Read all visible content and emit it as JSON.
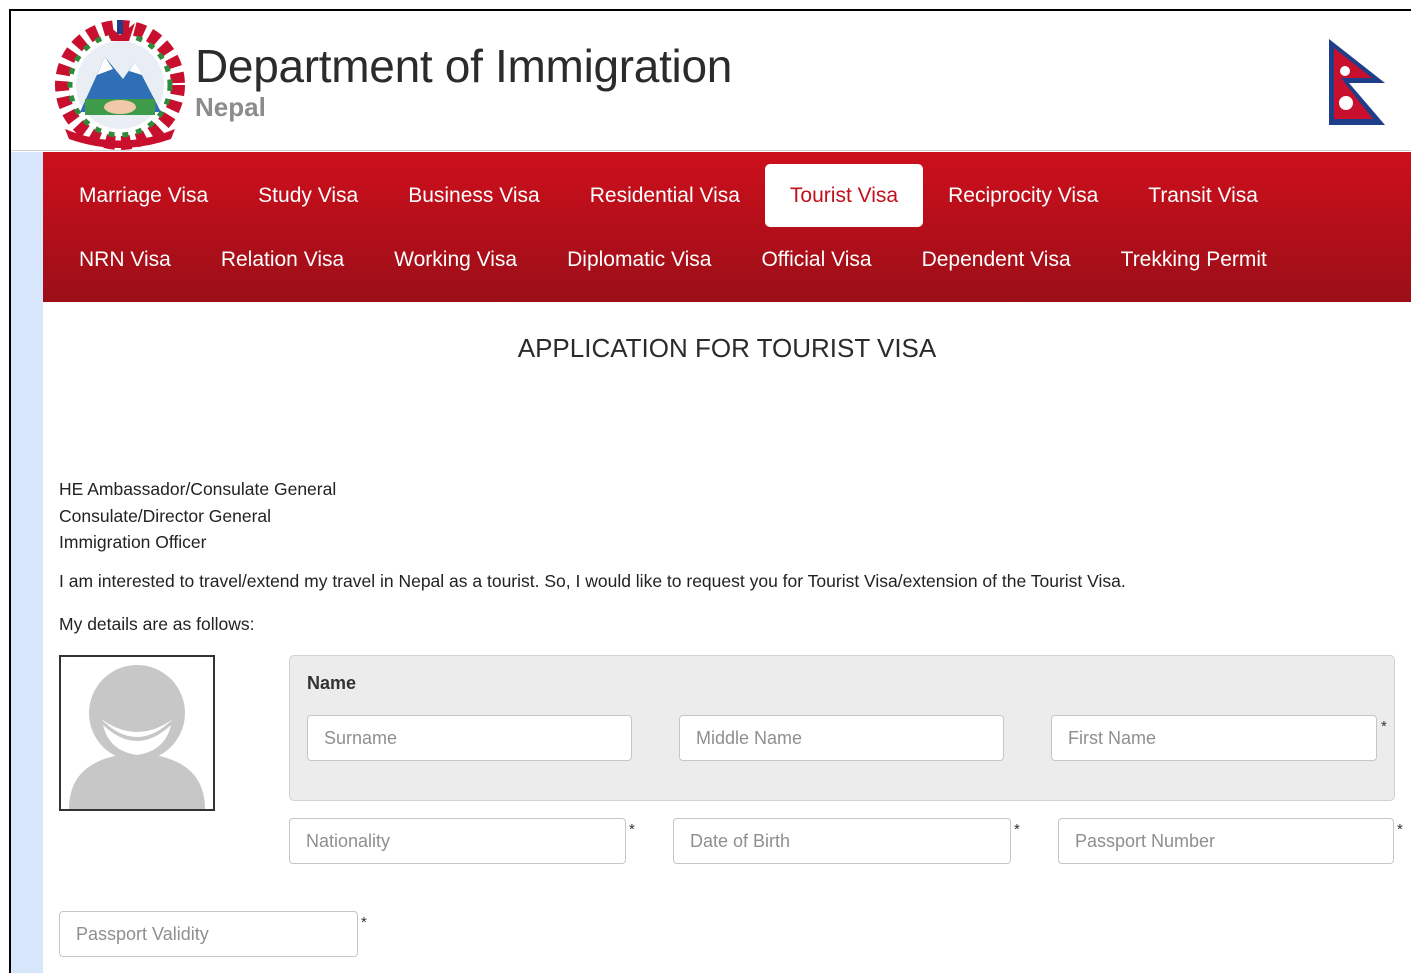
{
  "header": {
    "title": "Department of Immigration",
    "subtitle": "Nepal"
  },
  "nav": {
    "row1": [
      {
        "label": "Marriage Visa",
        "active": false
      },
      {
        "label": "Study Visa",
        "active": false
      },
      {
        "label": "Business Visa",
        "active": false
      },
      {
        "label": "Residential Visa",
        "active": false
      },
      {
        "label": "Tourist Visa",
        "active": true
      },
      {
        "label": "Reciprocity Visa",
        "active": false
      },
      {
        "label": "Transit Visa",
        "active": false
      }
    ],
    "row2": [
      {
        "label": "NRN Visa",
        "active": false
      },
      {
        "label": "Relation Visa",
        "active": false
      },
      {
        "label": "Working Visa",
        "active": false
      },
      {
        "label": "Diplomatic Visa",
        "active": false
      },
      {
        "label": "Official Visa",
        "active": false
      },
      {
        "label": "Dependent Visa",
        "active": false
      },
      {
        "label": "Trekking Permit",
        "active": false
      }
    ]
  },
  "page": {
    "heading": "APPLICATION FOR TOURIST VISA",
    "address_lines": [
      "HE Ambassador/Consulate General",
      "Consulate/Director General",
      "Immigration Officer"
    ],
    "request_text": "I am interested to travel/extend my travel in Nepal as a tourist. So, I would like to request you for Tourist Visa/extension of the Tourist Visa.",
    "details_intro": "My details are as follows:"
  },
  "form": {
    "name_label": "Name",
    "required_mark": "*",
    "surname_placeholder": "Surname",
    "middle_name_placeholder": "Middle Name",
    "first_name_placeholder": "First Name",
    "nationality_placeholder": "Nationality",
    "dob_placeholder": "Date of Birth",
    "passport_number_placeholder": "Passport Number",
    "passport_validity_placeholder": "Passport Validity"
  },
  "colors": {
    "nav_top": "#cd0f1c",
    "nav_bottom": "#9b0f18",
    "active_tab_text": "#c1121c",
    "side_stripe": "#d7e6fb"
  }
}
